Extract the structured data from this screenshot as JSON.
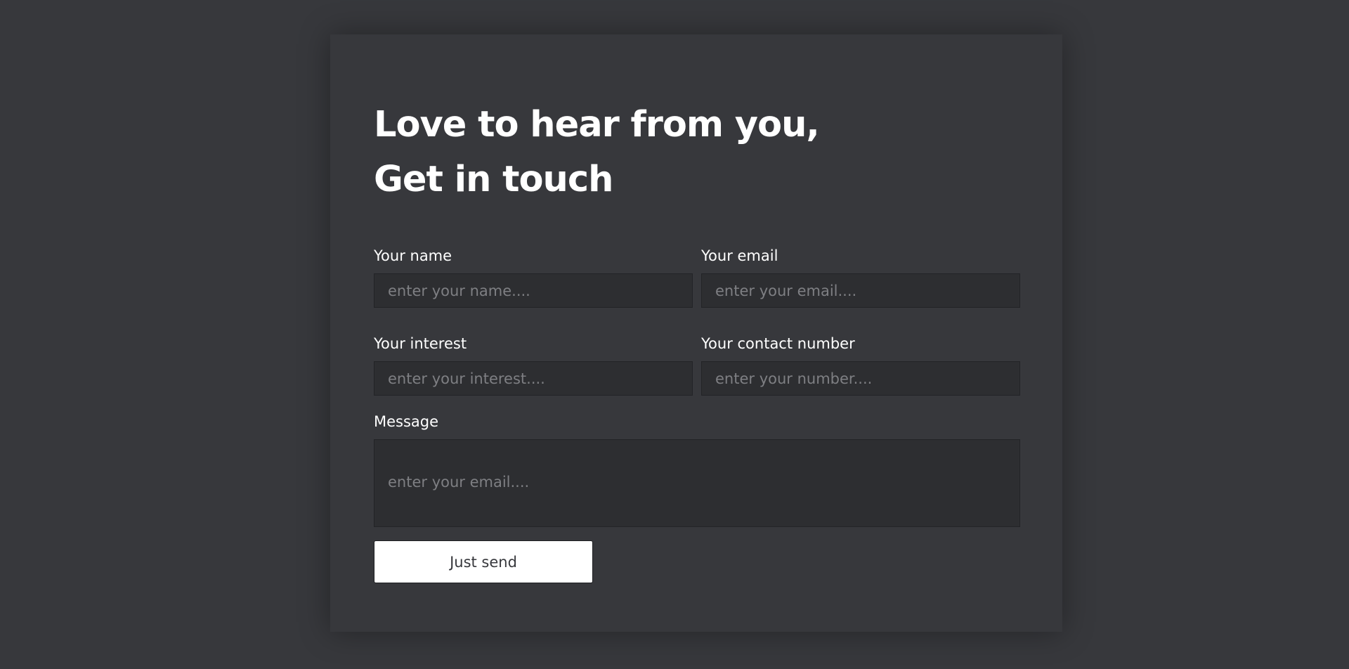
{
  "heading": {
    "line1": "Love to hear from you,",
    "line2": "Get in touch"
  },
  "form": {
    "name": {
      "label": "Your name",
      "placeholder": "enter your name...."
    },
    "email": {
      "label": "Your email",
      "placeholder": "enter your email...."
    },
    "interest": {
      "label": "Your interest",
      "placeholder": "enter your interest...."
    },
    "contact": {
      "label": "Your contact number",
      "placeholder": "enter your number...."
    },
    "message": {
      "label": "Message",
      "placeholder": "enter your email...."
    },
    "submit_label": "Just send"
  },
  "colors": {
    "background": "#37383c",
    "input_bg": "#2d2e31",
    "text": "#ffffff",
    "placeholder": "#7e7f83",
    "button_bg": "#ffffff"
  }
}
